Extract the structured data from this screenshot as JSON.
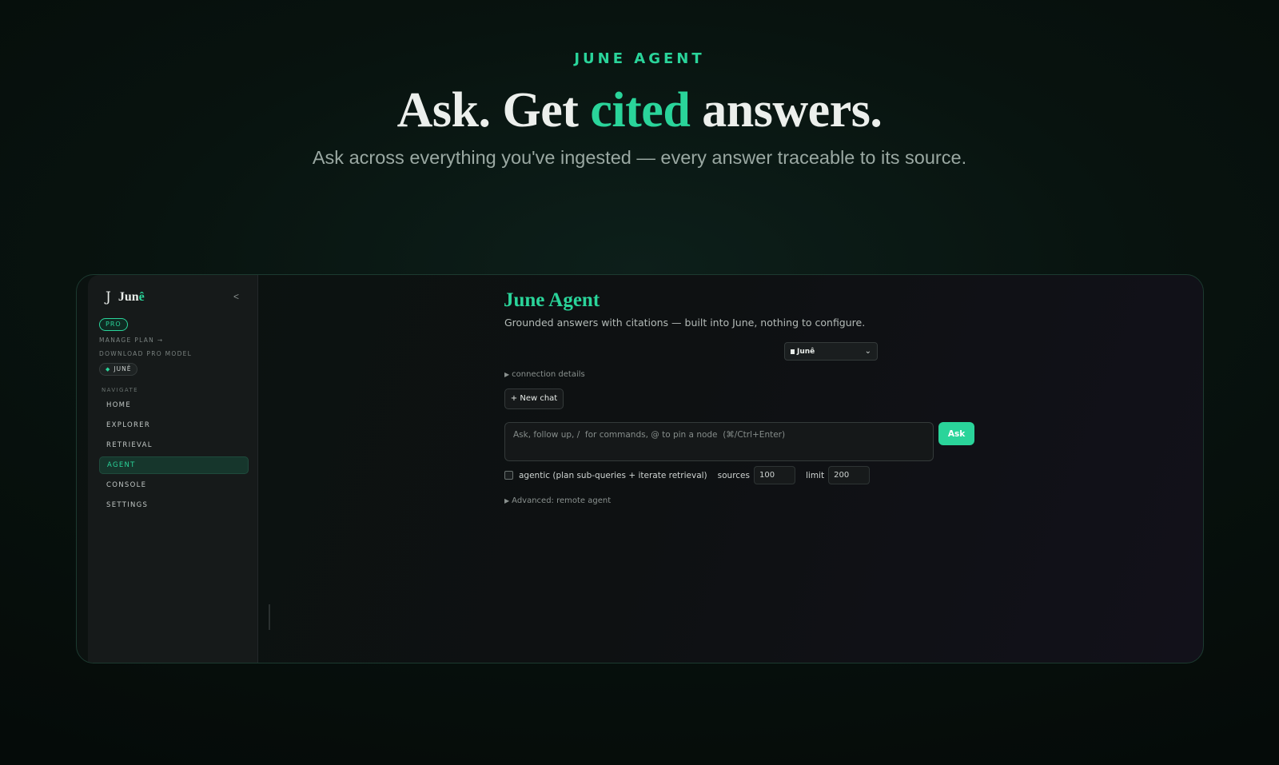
{
  "hero": {
    "eyebrow": "JUNE AGENT",
    "headline_before": "Ask. Get ",
    "headline_accent": "cited",
    "headline_after": " answers.",
    "subhead": "Ask across everything you've ingested — every answer traceable to its source."
  },
  "sidebar": {
    "brand_mark": "J",
    "brand_name_base": "Jun",
    "brand_name_accent": "ê",
    "collapse_label": "<",
    "plan_badge": "PRO",
    "manage_plan": "MANAGE PLAN →",
    "download_model": "DOWNLOAD PRO MODEL",
    "model_chip": "JUNÊ",
    "nav_label": "NAVIGATE",
    "nav_items": [
      {
        "label": "HOME",
        "active": false
      },
      {
        "label": "EXPLORER",
        "active": false
      },
      {
        "label": "RETRIEVAL",
        "active": false
      },
      {
        "label": "AGENT",
        "active": true
      },
      {
        "label": "CONSOLE",
        "active": false
      },
      {
        "label": "SETTINGS",
        "active": false
      }
    ]
  },
  "main": {
    "title": "June Agent",
    "description": "Grounded answers with citations — built into June, nothing to configure.",
    "model_select": "Junê",
    "connection_details": "connection details",
    "new_chat": "+ New chat",
    "prompt_placeholder": "Ask, follow up, /  for commands, @ to pin a node  (⌘/Ctrl+Enter)",
    "ask_button": "Ask",
    "agentic_label": "agentic (plan sub-queries + iterate retrieval)",
    "sources_label": "sources",
    "sources_value": "100",
    "limit_label": "limit",
    "limit_value": "200",
    "advanced": "Advanced: remote agent"
  },
  "colors": {
    "accent": "#2ad49a",
    "background": "#08130f",
    "panel": "#161a1a"
  }
}
